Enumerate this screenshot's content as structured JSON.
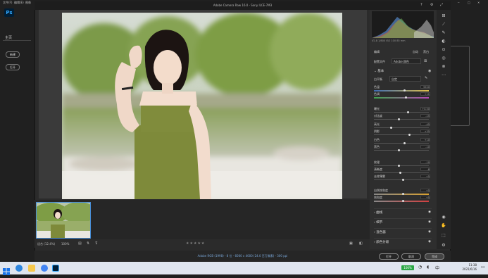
{
  "titlebar": {
    "menus": [
      "文件(F)",
      "编辑(E)",
      "图像"
    ],
    "window_icons": [
      "─",
      "□",
      "✕"
    ]
  },
  "ps": {
    "logo": "Ps",
    "left_panel_label": "主页",
    "buttons": [
      "新建",
      "打开"
    ]
  },
  "acr": {
    "title": "Adobe Camera Raw 16.0 - Sony ILCE-7M3",
    "histogram_info": "f/2.8   1/800   ISO 100   85 mm",
    "panel_header": {
      "edit_label": "编辑",
      "auto_label": "自动",
      "bw_label": "黑白"
    },
    "profile": {
      "label": "配置文件",
      "value": "Adobe 颜色"
    },
    "basic": {
      "title": "基本",
      "white_balance_label": "白平衡",
      "white_balance_value": "自定",
      "sliders": [
        {
          "label": "色温",
          "value": "5500"
        },
        {
          "label": "色调",
          "value": "+11"
        },
        {
          "label": "曝光",
          "value": "+0.50"
        },
        {
          "label": "对比度",
          "value": "-15"
        },
        {
          "label": "高光",
          "value": "-45"
        },
        {
          "label": "阴影",
          "value": "+35"
        },
        {
          "label": "白色",
          "value": "+10"
        },
        {
          "label": "黑色",
          "value": "-10"
        },
        {
          "label": "纹理",
          "value": "-10"
        },
        {
          "label": "清晰度",
          "value": "-8"
        },
        {
          "label": "去除薄雾",
          "value": "+5"
        },
        {
          "label": "自然饱和度",
          "value": "+5"
        },
        {
          "label": "饱和度",
          "value": "+5"
        }
      ]
    },
    "sections": [
      "曲线",
      "细节",
      "混色器",
      "颜色分级"
    ],
    "zoom_label": "适合 (12.4%)",
    "zoom_value": "100%",
    "info_bar": "Adobe RGB (1998) - 8 位 - 6000 x 4000 (24.0 百万像素) - 300 ppi",
    "stars": "★★★★★",
    "buttons": {
      "cancel": "取消",
      "done": "完成",
      "open": "打开"
    },
    "tools": [
      "⊞",
      "⟋",
      "✎",
      "◐",
      "⊙",
      "◎",
      "⊗",
      "⋯",
      "◉",
      "✋",
      "⬚",
      "⚙"
    ]
  },
  "taskbar": {
    "time": "11:38",
    "date": "2021/6/16",
    "battery": "100%"
  },
  "colors": {
    "accent": "#4a90d9",
    "dress": "#7e8a3a",
    "panel": "#2e2e2e"
  }
}
